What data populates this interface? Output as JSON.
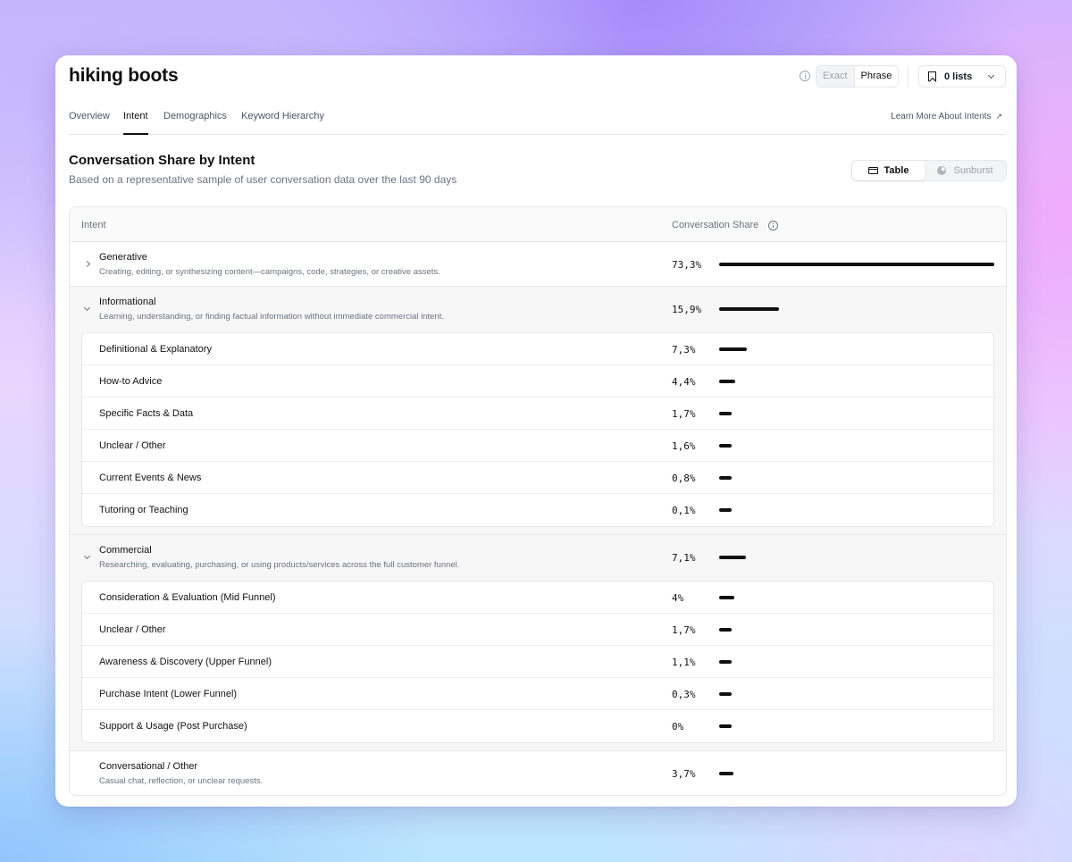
{
  "header": {
    "title": "hiking boots",
    "match": {
      "exact": "Exact",
      "phrase": "Phrase",
      "selected": "Phrase"
    },
    "lists_label": "0 lists"
  },
  "tabs": [
    {
      "label": "Overview"
    },
    {
      "label": "Intent",
      "active": true
    },
    {
      "label": "Demographics"
    },
    {
      "label": "Keyword Hierarchy"
    }
  ],
  "learn_more": "Learn More About Intents",
  "section": {
    "title": "Conversation Share by Intent",
    "subtitle": "Based on a representative sample of user conversation data over the last 90 days",
    "view_table": "Table",
    "view_sunburst": "Sunburst",
    "selected_view": "Table"
  },
  "table": {
    "col_intent": "Intent",
    "col_share": "Conversation Share",
    "groups": [
      {
        "name": "Generative",
        "desc": "Creating, editing, or synthesizing content—campaigns, code, strategies, or creative assets.",
        "share": "73,3%",
        "value": 73.3,
        "expanded": false,
        "children": []
      },
      {
        "name": "Informational",
        "desc": "Learning, understanding, or finding factual information without immediate commercial intent.",
        "share": "15,9%",
        "value": 15.9,
        "expanded": true,
        "children": [
          {
            "name": "Definitional & Explanatory",
            "share": "7,3%",
            "value": 7.3
          },
          {
            "name": "How-to Advice",
            "share": "4,4%",
            "value": 4.4
          },
          {
            "name": "Specific Facts & Data",
            "share": "1,7%",
            "value": 1.7
          },
          {
            "name": "Unclear / Other",
            "share": "1,6%",
            "value": 1.6
          },
          {
            "name": "Current Events & News",
            "share": "0,8%",
            "value": 0.8
          },
          {
            "name": "Tutoring or Teaching",
            "share": "0,1%",
            "value": 0.1
          }
        ]
      },
      {
        "name": "Commercial",
        "desc": "Researching, evaluating, purchasing, or using products/services across the full customer funnel.",
        "share": "7,1%",
        "value": 7.1,
        "expanded": true,
        "children": [
          {
            "name": "Consideration & Evaluation (Mid Funnel)",
            "share": "4%",
            "value": 4.0
          },
          {
            "name": "Unclear / Other",
            "share": "1,7%",
            "value": 1.7
          },
          {
            "name": "Awareness & Discovery (Upper Funnel)",
            "share": "1,1%",
            "value": 1.1
          },
          {
            "name": "Purchase Intent (Lower Funnel)",
            "share": "0,3%",
            "value": 0.3
          },
          {
            "name": "Support & Usage (Post Purchase)",
            "share": "0%",
            "value": 0
          }
        ]
      },
      {
        "name": "Conversational / Other",
        "desc": "Casual chat, reflection, or unclear requests.",
        "share": "3,7%",
        "value": 3.7,
        "expanded": false,
        "children": []
      }
    ]
  }
}
